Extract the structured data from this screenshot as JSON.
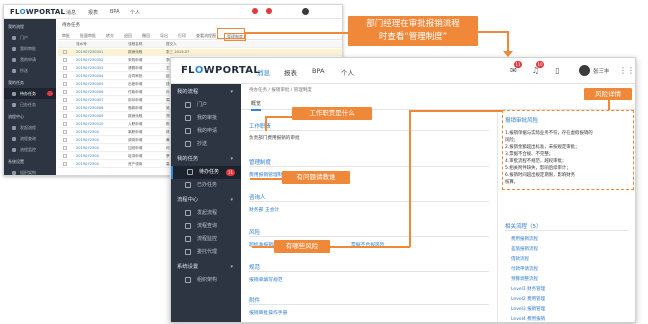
{
  "back_window": {
    "logo_main": "FL",
    "logo_accent": "O",
    "logo_rest": "WPORTAL",
    "nav": [
      "消息",
      "报表",
      "BPA",
      "个人"
    ],
    "sidebar": [
      {
        "label": "我的流程",
        "section": true
      },
      {
        "label": "门户"
      },
      {
        "label": "我的审批"
      },
      {
        "label": "我的申请"
      },
      {
        "label": "抄送"
      },
      {
        "label": "我的任务",
        "section": true
      },
      {
        "label": "待办任务",
        "active": true
      },
      {
        "label": "已办任务"
      },
      {
        "label": "流程中心",
        "section": true
      },
      {
        "label": "发起流程"
      },
      {
        "label": "流程查询"
      },
      {
        "label": "流程监控"
      },
      {
        "label": "系统设置",
        "section": true
      },
      {
        "label": "组织架构"
      }
    ],
    "title": "待办任务",
    "toolbar": [
      "审批",
      "批量审批",
      "转交",
      "退回",
      "撤回",
      "导出",
      "打印",
      "查看流程图",
      "管理制度"
    ],
    "table_header": [
      "流水号",
      "流程名称",
      "提交人"
    ],
    "rows": [
      {
        "id": "201907230001",
        "name": "报销流程",
        "who": "张三 2019-07"
      },
      {
        "id": "201907230002",
        "name": "采购申请",
        "who": "李四"
      },
      {
        "id": "201907230003",
        "name": "请假申请",
        "who": "王五"
      },
      {
        "id": "201907230004",
        "name": "合同审批",
        "who": "赵六"
      },
      {
        "id": "201907230005",
        "name": "出差申请",
        "who": "钱七"
      },
      {
        "id": "201907230006",
        "name": "付款申请",
        "who": "孙八"
      },
      {
        "id": "201907230007",
        "name": "用印申请",
        "who": "周九"
      },
      {
        "id": "201907230008",
        "name": "借款申请",
        "who": "吴十"
      },
      {
        "id": "201907230009",
        "name": "报销流程",
        "who": "郑一"
      },
      {
        "id": "201907230010",
        "name": "入职申请",
        "who": "陈二"
      },
      {
        "id": "2019072300",
        "name": "离职申请",
        "who": "林三"
      },
      {
        "id": "2019072300",
        "name": "调岗申请",
        "who": "黄四"
      },
      {
        "id": "2019072300",
        "name": "加班申请",
        "who": "何五"
      },
      {
        "id": "2019072300",
        "name": "培训申请",
        "who": "罗六"
      },
      {
        "id": "2019072300",
        "name": "资产领用",
        "who": "高七"
      }
    ]
  },
  "front_window": {
    "logo_main": "FL",
    "logo_accent": "O",
    "logo_rest": "WPORTAL",
    "nav": [
      "消息",
      "报表",
      "BPA",
      "个人"
    ],
    "badges": [
      "11",
      "10"
    ],
    "user": "张三丰",
    "sidebar": [
      {
        "label": "我的流程",
        "section": true
      },
      {
        "label": "门户"
      },
      {
        "label": "我的审批"
      },
      {
        "label": "我的申请"
      },
      {
        "label": "抄送"
      },
      {
        "label": "我的任务",
        "section": true
      },
      {
        "label": "待办任务",
        "active": true,
        "badge": "11"
      },
      {
        "label": "已办任务"
      },
      {
        "label": "流程中心",
        "section": true
      },
      {
        "label": "发起流程"
      },
      {
        "label": "流程查询"
      },
      {
        "label": "流程监控"
      },
      {
        "label": "委托代理"
      },
      {
        "label": "系统设置",
        "section": true
      },
      {
        "label": "组织架构"
      }
    ],
    "breadcrumb": "待办任务 / 报销审批 / 管理制度",
    "tab": "概览",
    "section1_title": "工作职责",
    "section1_text": "负责部门费用报销的审批",
    "section2_title": "管理制度",
    "section2_link": "费用报销管理制度",
    "section3_title": "咨询人",
    "section3_link": "财务部 王会计",
    "section4_title": "风险",
    "section4_links": [
      "超标准报销风险",
      "票据不合规风险"
    ],
    "section5_title": "规范",
    "section5_link": "报销单填写规范",
    "section6_title": "附件",
    "section6_link": "报销审批操作手册",
    "risk_title": "报销审批风险",
    "risk_lines": [
      "1.报销单据与实际业务不符，存在虚假报销的",
      "风险；",
      "2.报销金额超出标准，未按规定审批；",
      "3.票据不合规、不完整；",
      "4.审批流程不规范，越权审批；",
      "5.相关附件缺失，影响后续审计；",
      "6.报销时间超出规定期限，影响财务",
      "核算。"
    ],
    "related_title": "相关流程（5）",
    "related_links": [
      "费用报销流程",
      "差旅报销流程",
      "借款流程",
      "付款申请流程",
      "预算调整流程",
      "Level1 财务管理",
      "Level2 费用管理",
      "Level3 报销管理",
      "Level4 费用报销"
    ]
  },
  "annotations": {
    "top_callout": [
      "部门经理在审批报销流程",
      "时查看“管理制度”"
    ],
    "risk_detail": "风险详情",
    "job_duty": "工作职责是什么",
    "ask_who": "有问题请教谁",
    "risks": "有哪些风险"
  },
  "colors": {
    "accent_orange": "#f0883a",
    "sidebar_dark": "#2d3542",
    "link_blue": "#2f7cd3"
  }
}
